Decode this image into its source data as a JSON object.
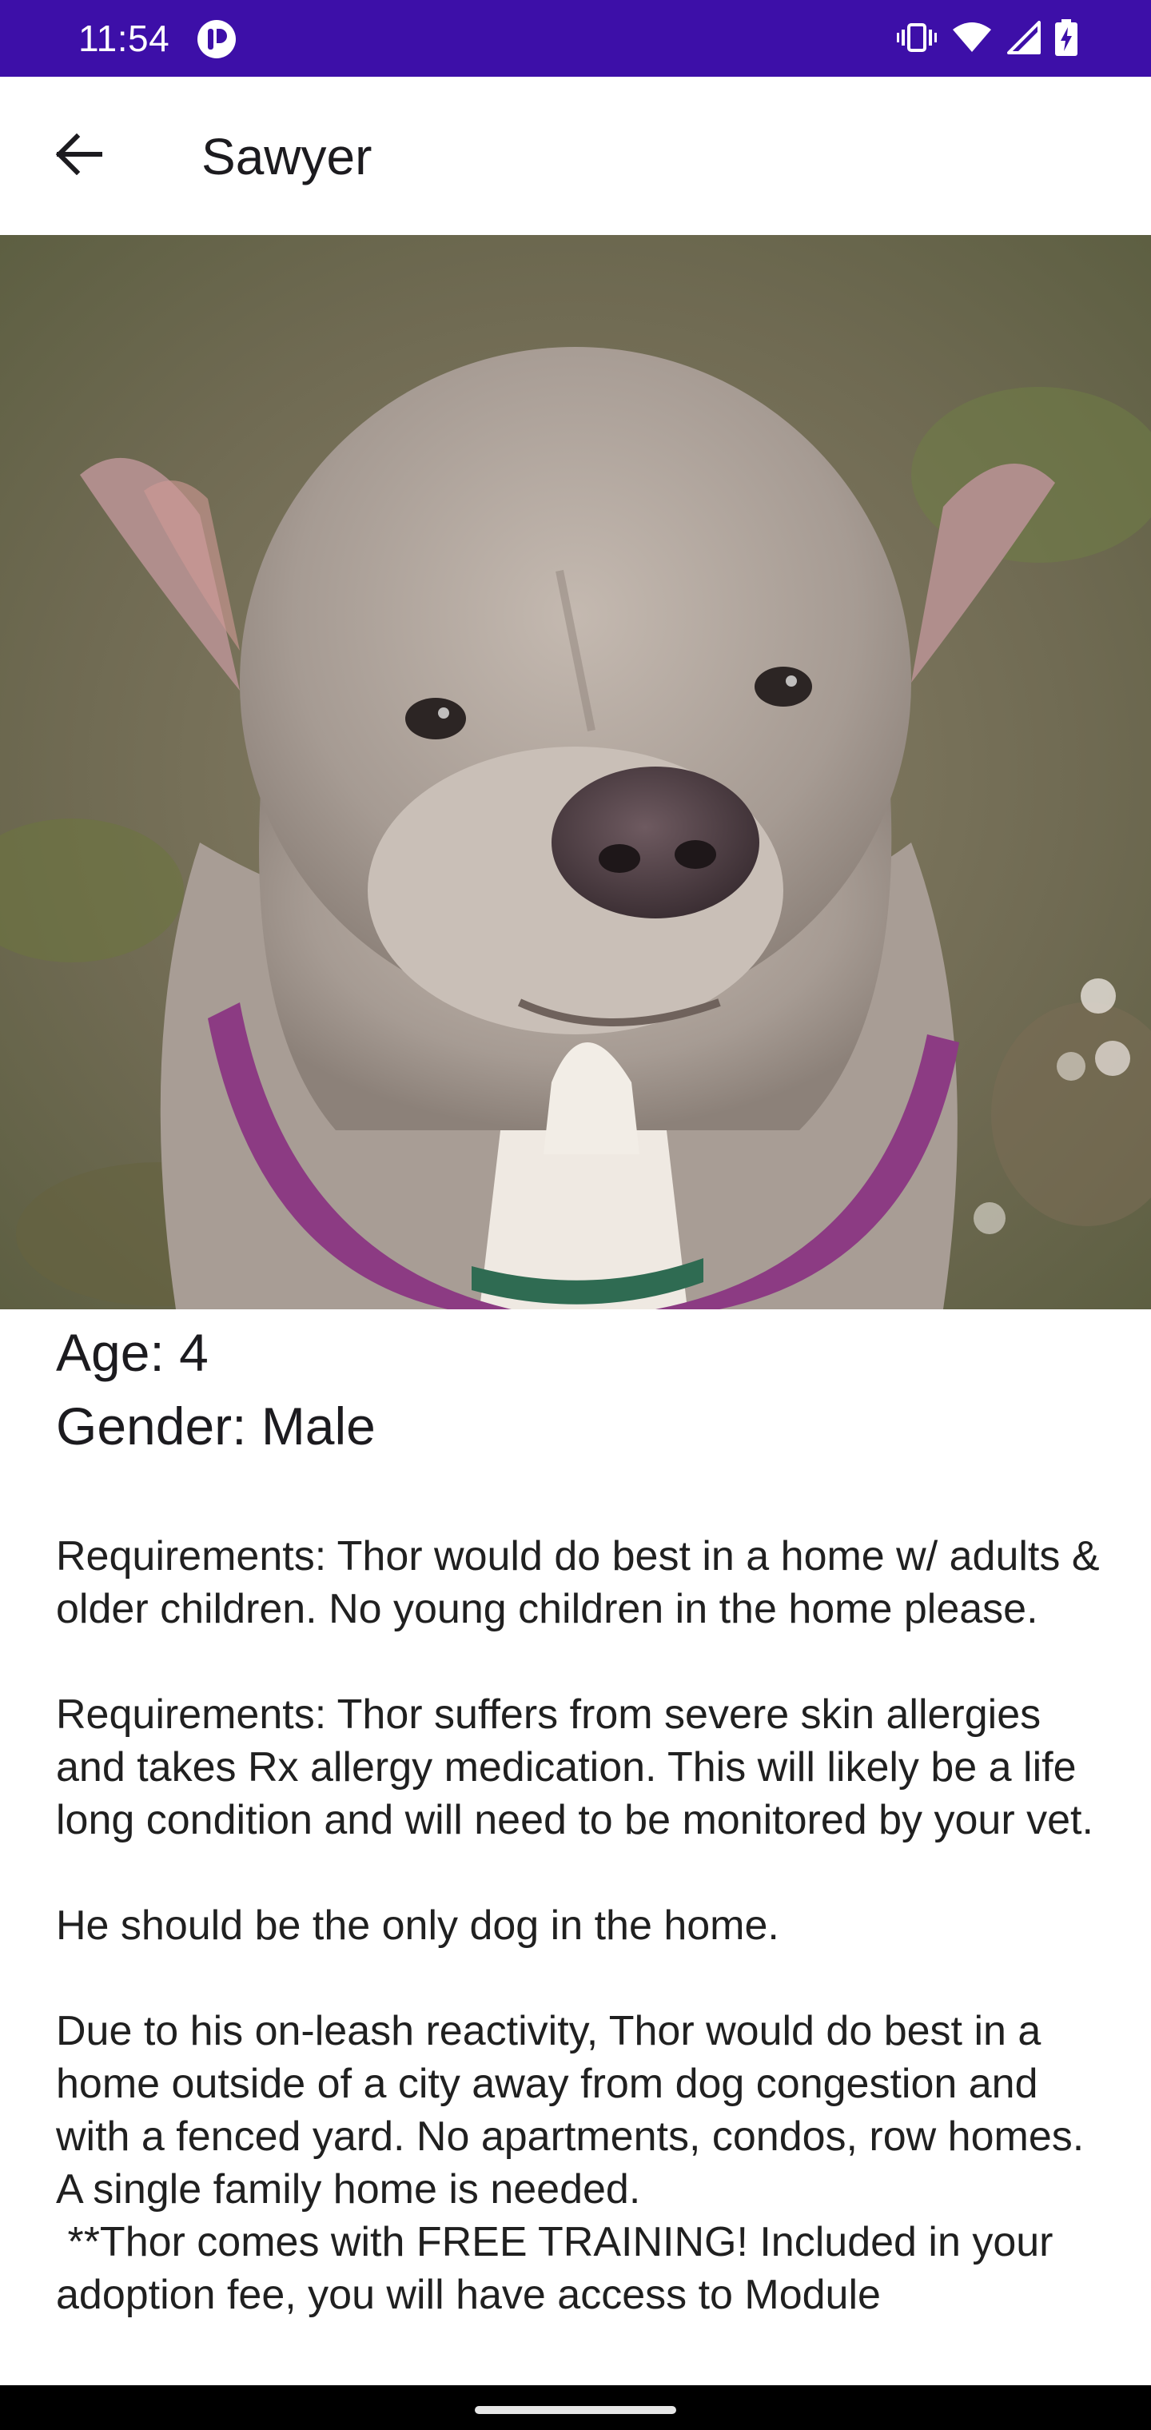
{
  "status_bar": {
    "time": "11:54",
    "background_color": "#3d0fa8",
    "icons": [
      "app-notification-icon",
      "vibrate-icon",
      "wifi-icon",
      "signal-icon",
      "battery-charging-icon"
    ]
  },
  "app_bar": {
    "title": "Sawyer",
    "back_icon": "arrow-back-icon"
  },
  "hero_image": {
    "subject": "dog-photo"
  },
  "details": {
    "age_line": "Age: 4",
    "gender_line": "Gender: Male",
    "description": "Requirements: Thor would do best in a home w/ adults & older children. No young children in the home please.\n\nRequirements: Thor suffers from severe skin allergies and takes Rx allergy medication. This will likely be a life long condition and will need to be monitored by your vet.\n\nHe should be the only dog in the home.\n\nDue to his on-leash reactivity, Thor would do best in a home outside of a city away from dog congestion and with a fenced yard. No apartments, condos, row homes. A single family home is needed.\n **Thor comes with FREE TRAINING! Included in your adoption fee, you will have access to Module"
  },
  "nav_bar": {
    "handle": "gesture-handle"
  }
}
